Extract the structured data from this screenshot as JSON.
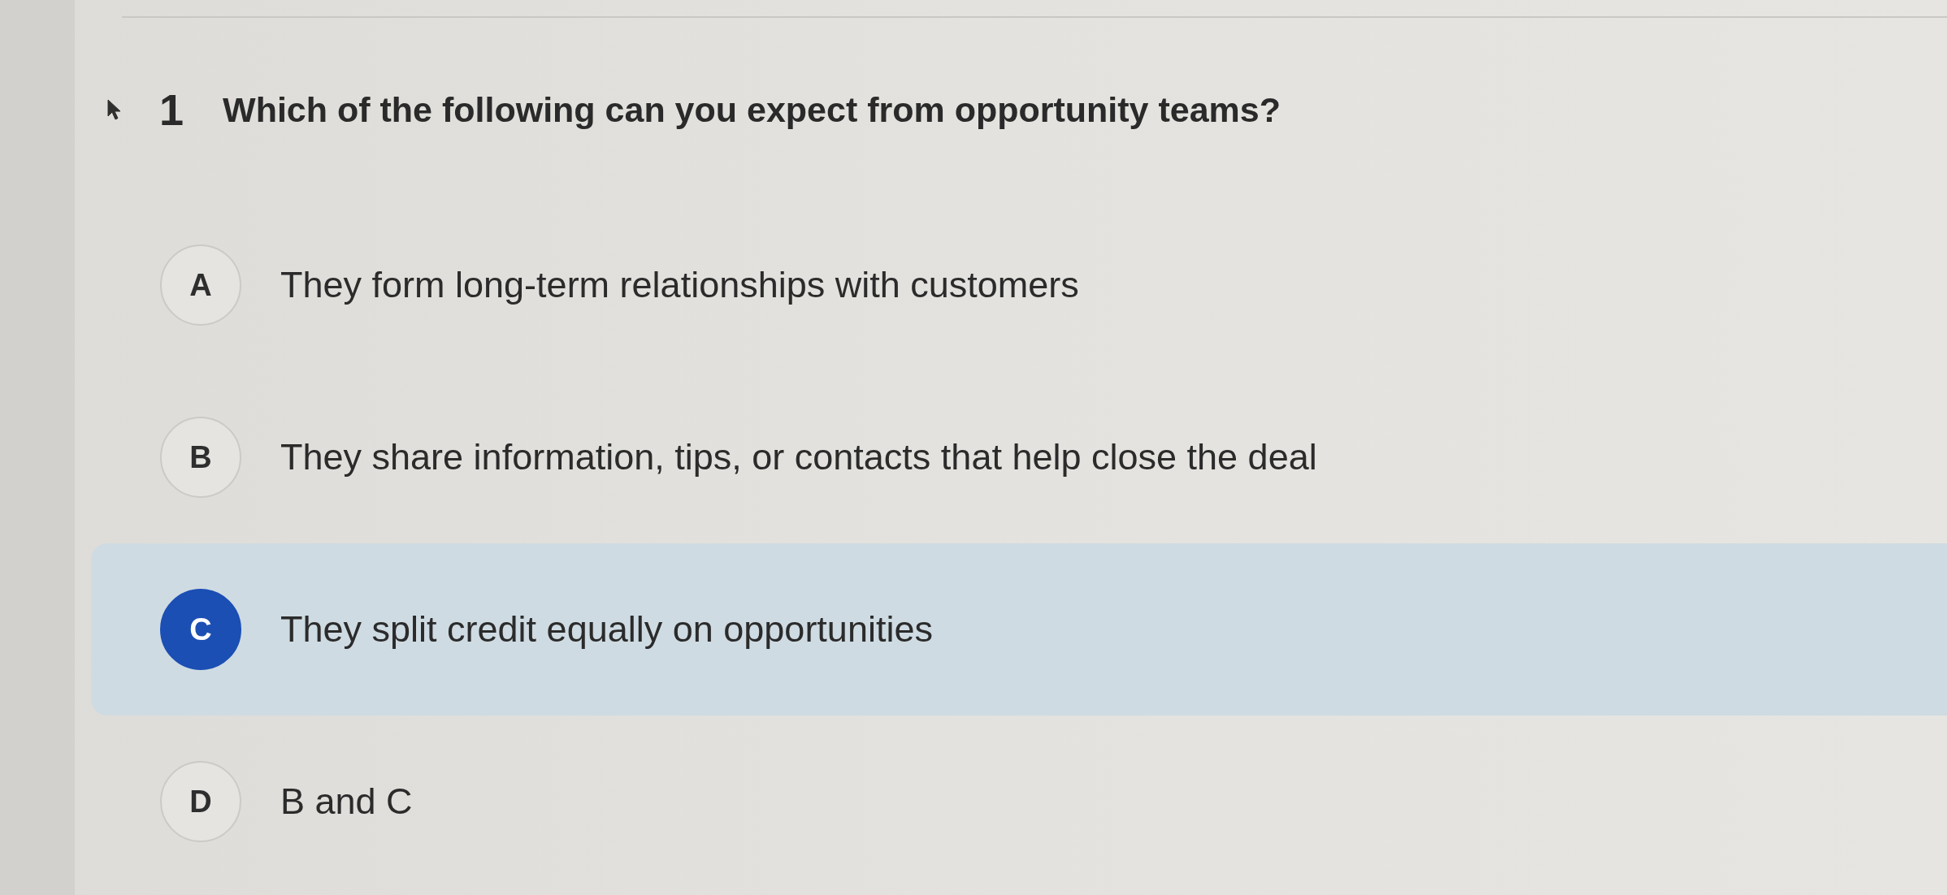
{
  "question": {
    "number": "1",
    "text": "Which of the following can you expect from opportunity teams?"
  },
  "options": [
    {
      "letter": "A",
      "text": "They form long-term relationships with customers",
      "selected": false
    },
    {
      "letter": "B",
      "text": "They share information, tips, or contacts that help close the deal",
      "selected": false
    },
    {
      "letter": "C",
      "text": "They split credit equally on opportunities",
      "selected": true
    },
    {
      "letter": "D",
      "text": "B and C",
      "selected": false
    }
  ]
}
